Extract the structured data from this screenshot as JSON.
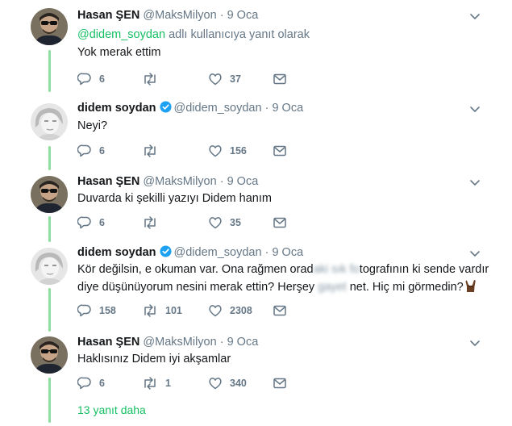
{
  "tweets": [
    {
      "name": "Hasan ŞEN",
      "handle": "@MaksMilyon",
      "sep": "·",
      "time": "9 Oca",
      "reply_mention": "@didem_soydan",
      "reply_suffix": " adlı kullanıcıya yanıt olarak",
      "text": "Yok merak ettim",
      "replies": "6",
      "retweets": "",
      "likes": "37"
    },
    {
      "name": "didem soydan",
      "handle": "@didem_soydan",
      "sep": "·",
      "time": "9 Oca",
      "text": "Neyi?",
      "replies": "6",
      "retweets": "",
      "likes": "156"
    },
    {
      "name": "Hasan ŞEN",
      "handle": "@MaksMilyon",
      "sep": "·",
      "time": "9 Oca",
      "text": "Duvarda ki şekilli yazıyı Didem hanım",
      "replies": "6",
      "retweets": "",
      "likes": "35"
    },
    {
      "name": "didem soydan",
      "handle": "@didem_soydan",
      "sep": "·",
      "time": "9 Oca",
      "text_line1_a": "Kör değilsin, e okuman var. Ona rağmen orad",
      "text_line1_blur1": "aki sık fo",
      "text_line1_b": "tografının ki sende vardır",
      "text_line2_a": "diye düşünüyorum nesini merak ettin? Herşey ",
      "text_line2_blur": "gayet",
      "text_line2_b": " net. Hiç mi görmedin?",
      "replies": "158",
      "retweets": "101",
      "likes": "2308"
    },
    {
      "name": "Hasan ŞEN",
      "handle": "@MaksMilyon",
      "sep": "·",
      "time": "9 Oca",
      "text": "Haklısınız Didem iyi akşamlar",
      "replies": "6",
      "retweets": "1",
      "likes": "340"
    }
  ],
  "more_replies": "13 yanıt daha",
  "colors": {
    "accent_green": "#17bf63",
    "thread_line": "#8fdda0",
    "muted": "#657786",
    "verified_blue": "#1da1f2"
  }
}
